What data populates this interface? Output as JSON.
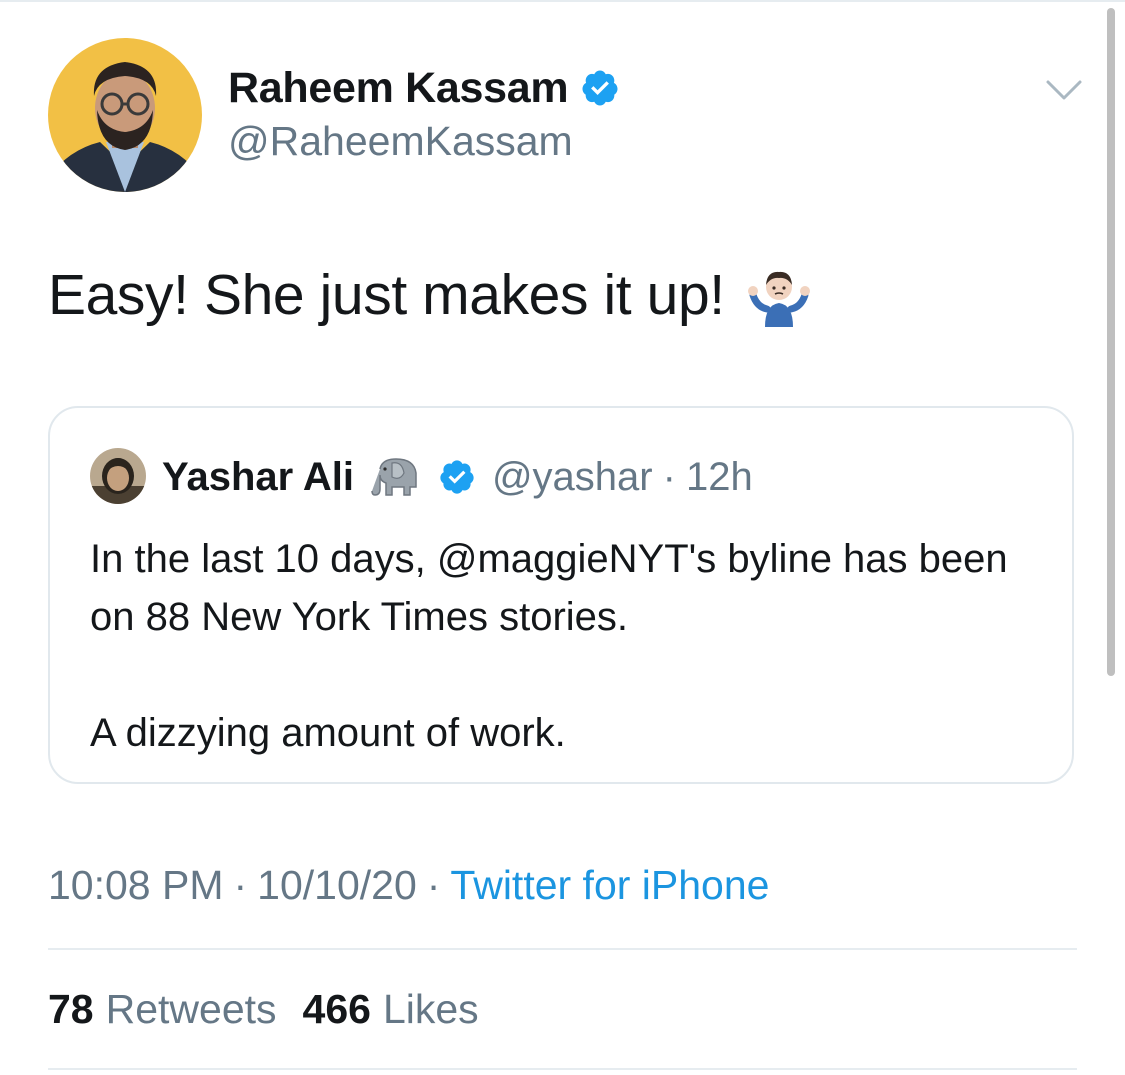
{
  "tweet": {
    "author": {
      "name": "Raheem Kassam",
      "handle": "@RaheemKassam",
      "avatar_bg": "#f2c045"
    },
    "text": "Easy! She just makes it up!",
    "emoji_icon": "person-shrugging-icon",
    "quoted": {
      "name": "Yashar Ali",
      "name_emoji_icon": "elephant-icon",
      "handle": "@yashar",
      "separator": "·",
      "time": "12h",
      "paragraphs": [
        "In the last 10 days, @maggieNYT's byline has been on 88 New York Times stories.",
        "A dizzying amount of work."
      ]
    },
    "meta": {
      "time": "10:08 PM",
      "separator": "·",
      "date": "10/10/20",
      "source": "Twitter for iPhone"
    },
    "stats": {
      "retweets_count": "78",
      "retweets_label": "Retweets",
      "likes_count": "466",
      "likes_label": "Likes"
    }
  },
  "colors": {
    "text": "#14171a",
    "secondary": "#657786",
    "link": "#1b95e0",
    "verified": "#1da1f2",
    "border": "#e1e8ed"
  }
}
